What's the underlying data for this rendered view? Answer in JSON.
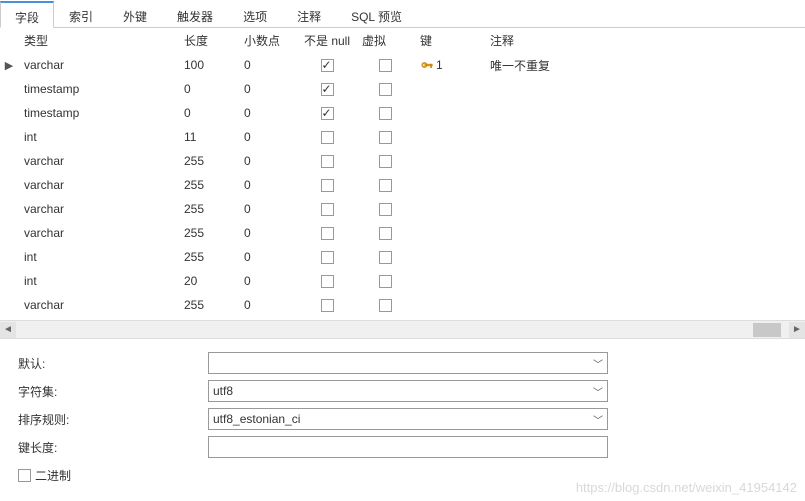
{
  "tabs": [
    {
      "id": "fields",
      "label": "字段",
      "active": true
    },
    {
      "id": "indexes",
      "label": "索引",
      "active": false
    },
    {
      "id": "fk",
      "label": "外键",
      "active": false
    },
    {
      "id": "triggers",
      "label": "触发器",
      "active": false
    },
    {
      "id": "options",
      "label": "选项",
      "active": false
    },
    {
      "id": "comment",
      "label": "注释",
      "active": false
    },
    {
      "id": "sqlpreview",
      "label": "SQL 预览",
      "active": false
    }
  ],
  "columns": {
    "type": "类型",
    "length": "长度",
    "decimals": "小数点",
    "notnull": "不是 null",
    "virtual": "虚拟",
    "key": "键",
    "comment": "注释"
  },
  "rows": [
    {
      "marker": "▶",
      "type": "varchar",
      "length": "100",
      "decimals": "0",
      "notnull": true,
      "virtual": false,
      "key": "1",
      "key_is_primary": true,
      "comment": "唯一不重复"
    },
    {
      "marker": "",
      "type": "timestamp",
      "length": "0",
      "decimals": "0",
      "notnull": true,
      "virtual": false,
      "key": "",
      "comment": ""
    },
    {
      "marker": "",
      "type": "timestamp",
      "length": "0",
      "decimals": "0",
      "notnull": true,
      "virtual": false,
      "key": "",
      "comment": ""
    },
    {
      "marker": "",
      "type": "int",
      "length": "11",
      "decimals": "0",
      "notnull": false,
      "virtual": false,
      "key": "",
      "comment": ""
    },
    {
      "marker": "",
      "type": "varchar",
      "length": "255",
      "decimals": "0",
      "notnull": false,
      "virtual": false,
      "key": "",
      "comment": ""
    },
    {
      "marker": "",
      "type": "varchar",
      "length": "255",
      "decimals": "0",
      "notnull": false,
      "virtual": false,
      "key": "",
      "comment": ""
    },
    {
      "marker": "",
      "type": "varchar",
      "length": "255",
      "decimals": "0",
      "notnull": false,
      "virtual": false,
      "key": "",
      "comment": ""
    },
    {
      "marker": "",
      "type": "varchar",
      "length": "255",
      "decimals": "0",
      "notnull": false,
      "virtual": false,
      "key": "",
      "comment": ""
    },
    {
      "marker": "",
      "type": "int",
      "length": "255",
      "decimals": "0",
      "notnull": false,
      "virtual": false,
      "key": "",
      "comment": ""
    },
    {
      "marker": "",
      "type": "int",
      "length": "20",
      "decimals": "0",
      "notnull": false,
      "virtual": false,
      "key": "",
      "comment": ""
    },
    {
      "marker": "",
      "type": "varchar",
      "length": "255",
      "decimals": "0",
      "notnull": false,
      "virtual": false,
      "key": "",
      "comment": ""
    }
  ],
  "props": {
    "default_label": "默认:",
    "default_value": "",
    "charset_label": "字符集:",
    "charset_value": "utf8",
    "collation_label": "排序规则:",
    "collation_value": "utf8_estonian_ci",
    "keylen_label": "键长度:",
    "keylen_value": "",
    "binary_label": "二进制"
  },
  "watermark": "https://blog.csdn.net/weixin_41954142"
}
